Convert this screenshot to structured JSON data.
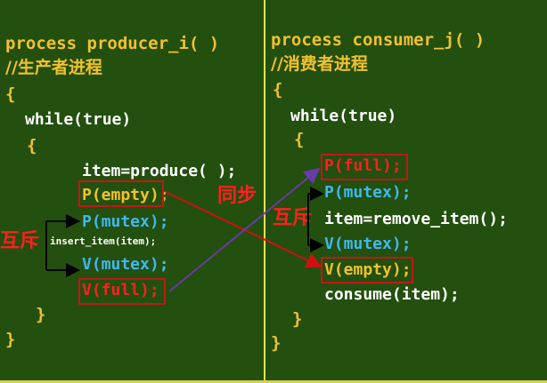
{
  "producer": {
    "title": "process producer_i( )",
    "comment": "//生产者进程",
    "open_brace": "{",
    "while": "while(true)",
    "inner_open": "{",
    "item": "item=produce( );",
    "p_empty": "P(empty);",
    "p_mutex": "P(mutex);",
    "insert": "insert_item(item);",
    "v_mutex": "V(mutex);",
    "v_full": "V(full);",
    "inner_close": "}",
    "close_brace": "}"
  },
  "consumer": {
    "title": "process consumer_j( )",
    "comment": "//消费者进程",
    "open_brace": "{",
    "while": "while(true)",
    "inner_open": "{",
    "p_full": "P(full);",
    "p_mutex": "P(mutex);",
    "remove": "item=remove_item();",
    "v_mutex": "V(mutex);",
    "v_empty": "V(empty);",
    "consume": "consume(item);",
    "inner_close": "}",
    "close_brace": "}"
  },
  "labels": {
    "sync": "同步",
    "mutex_left": "互斥",
    "mutex_right": "互斥"
  },
  "colors": {
    "background": "#234f0f",
    "keyword_yellow": "#f2c12e",
    "cyan": "#3fb8f0",
    "red": "#ff2020",
    "divider": "#e9e34a"
  }
}
